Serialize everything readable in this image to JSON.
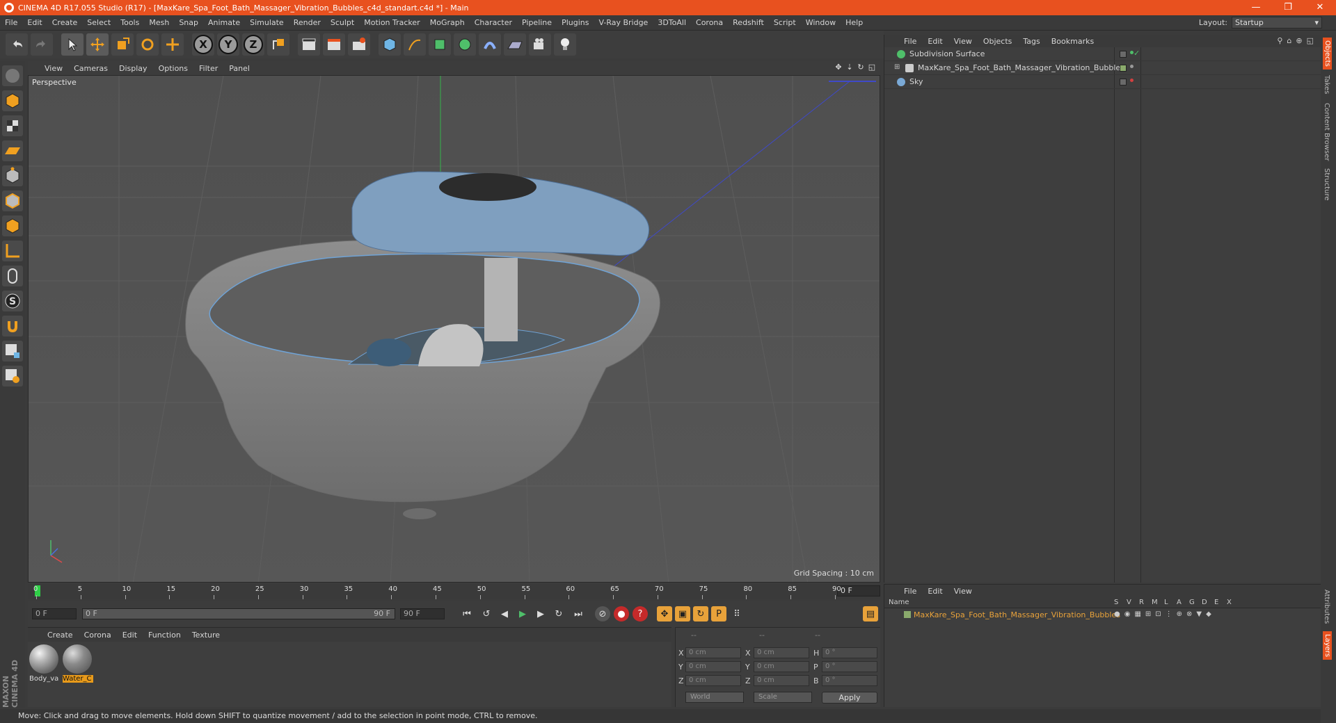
{
  "window": {
    "title": "CINEMA 4D R17.055 Studio (R17) - [MaxKare_Spa_Foot_Bath_Massager_Vibration_Bubbles_c4d_standart.c4d *] - Main",
    "controls": [
      "—",
      "❐",
      "✕"
    ]
  },
  "menubar": {
    "items": [
      "File",
      "Edit",
      "Create",
      "Select",
      "Tools",
      "Mesh",
      "Snap",
      "Animate",
      "Simulate",
      "Render",
      "Sculpt",
      "Motion Tracker",
      "MoGraph",
      "Character",
      "Pipeline",
      "Plugins",
      "V-Ray Bridge",
      "3DToAll",
      "Corona",
      "Redshift",
      "Script",
      "Window",
      "Help"
    ],
    "layout_label": "Layout:",
    "layout_value": "Startup"
  },
  "toolbar": {
    "axis_labels": [
      "X",
      "Y",
      "Z"
    ]
  },
  "viewport": {
    "menu": [
      "View",
      "Cameras",
      "Display",
      "Options",
      "Filter",
      "Panel"
    ],
    "label": "Perspective",
    "grid_spacing": "Grid Spacing : 10 cm"
  },
  "object_manager": {
    "menu": [
      "File",
      "Edit",
      "View",
      "Objects",
      "Tags",
      "Bookmarks"
    ],
    "objects": [
      {
        "name": "Subdivision Surface",
        "icon_color": "#4fbf6a"
      },
      {
        "name": "MaxKare_Spa_Foot_Bath_Massager_Vibration_Bubbles",
        "icon_color": "#cccccc"
      },
      {
        "name": "Sky",
        "icon_color": "#7aa9d6"
      }
    ]
  },
  "side_tabs": [
    "Objects",
    "Takes",
    "Content Browser",
    "Structure",
    "Attributes",
    "Layers"
  ],
  "timeline": {
    "ticks": [
      "0",
      "5",
      "10",
      "15",
      "20",
      "25",
      "30",
      "35",
      "40",
      "45",
      "50",
      "55",
      "60",
      "65",
      "70",
      "75",
      "80",
      "85",
      "90"
    ],
    "current_frame": "0 F"
  },
  "transport": {
    "start_field": "0 F",
    "range_start": "0 F",
    "range_end": "90 F",
    "end_field": "90 F"
  },
  "material_manager": {
    "menu": [
      "Create",
      "Corona",
      "Edit",
      "Function",
      "Texture"
    ],
    "materials": [
      {
        "label": "Body_va",
        "selected": false
      },
      {
        "label": "Water_C",
        "selected": true
      }
    ]
  },
  "coordinates": {
    "headers": [
      "--",
      "--",
      "--"
    ],
    "rows": [
      {
        "axis": "X",
        "pos": "0 cm",
        "axis2": "X",
        "size": "0 cm",
        "rot_label": "H",
        "rot": "0 °"
      },
      {
        "axis": "Y",
        "pos": "0 cm",
        "axis2": "Y",
        "size": "0 cm",
        "rot_label": "P",
        "rot": "0 °"
      },
      {
        "axis": "Z",
        "pos": "0 cm",
        "axis2": "Z",
        "size": "0 cm",
        "rot_label": "B",
        "rot": "0 °"
      }
    ],
    "mode_select": "World",
    "type_select": "Scale",
    "apply_label": "Apply"
  },
  "layer_manager": {
    "menu": [
      "File",
      "Edit",
      "View"
    ],
    "columns": [
      "Name",
      "S",
      "V",
      "R",
      "M",
      "L",
      "A",
      "G",
      "D",
      "E",
      "X"
    ],
    "layer_name": "MaxKare_Spa_Foot_Bath_Massager_Vibration_Bubbles"
  },
  "status": "Move: Click and drag to move elements. Hold down SHIFT to quantize movement / add to the selection in point mode, CTRL to remove.",
  "logo": "MAXON CINEMA 4D"
}
